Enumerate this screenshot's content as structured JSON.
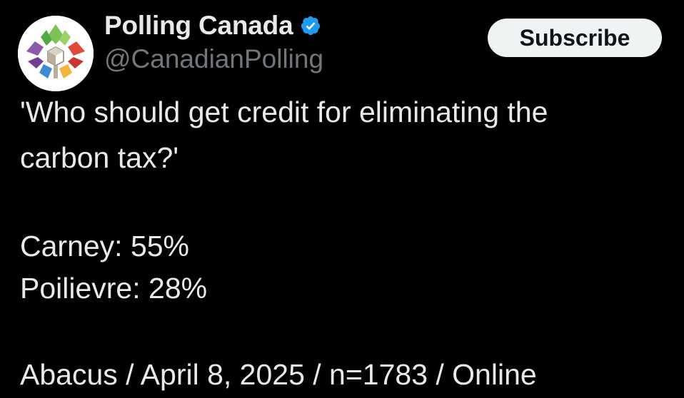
{
  "author": {
    "display_name": "Polling Canada",
    "handle": "@CanadianPolling",
    "verified": true,
    "avatar_icon": "maple-leaf-quilt-logo-icon",
    "verified_color": "#1d9bf0"
  },
  "actions": {
    "subscribe_label": "Subscribe"
  },
  "post": {
    "question_line_1": "'Who should get credit for eliminating the",
    "question_line_2": "carbon tax?'",
    "result_1": "Carney: 55%",
    "result_2": "Poilievre: 28%",
    "source": "Abacus / April 8, 2025 / n=1783 / Online"
  },
  "colors": {
    "background": "#000000",
    "text_primary": "#e7e9ea",
    "text_secondary": "#71767b",
    "button_bg": "#eff3f4",
    "button_text": "#0f1419"
  }
}
